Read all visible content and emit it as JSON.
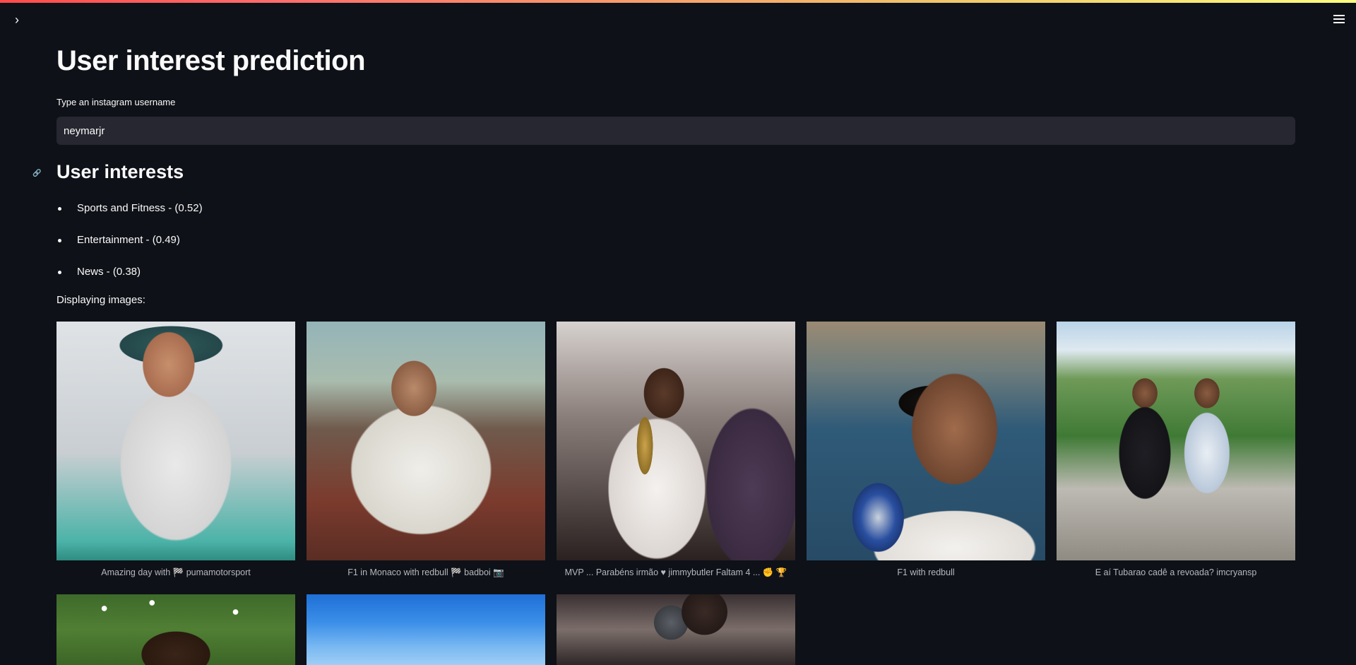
{
  "header": {
    "sidebar_toggle_icon": "chevron-right-icon",
    "menu_icon": "hamburger-menu-icon",
    "accent_gradient": [
      "#ff4b4b",
      "#fffd80"
    ]
  },
  "page": {
    "title": "User interest prediction",
    "input_label": "Type an instagram username",
    "input_value": "neymarjr",
    "interests_heading": "User interests",
    "interests": [
      "Sports and Fitness - (0.52)",
      "Entertainment - (0.49)",
      "News - (0.38)"
    ],
    "displaying_text": "Displaying images:"
  },
  "gallery": {
    "captions": [
      "Amazing day with 🏁 pumamotorsport",
      "F1 in Monaco with redbull 🏁 badboi 📷",
      "MVP ... Parabéns irmão ♥ jimmybutler Faltam 4 ... ✊ 🏆",
      "F1 with redbull",
      "E aí Tubarao cadê a revoada? imcryansp"
    ]
  },
  "colors": {
    "background": "#0e1117",
    "input_background": "#262730",
    "text": "#fafafa",
    "caption_text": "#b5b8c0"
  }
}
